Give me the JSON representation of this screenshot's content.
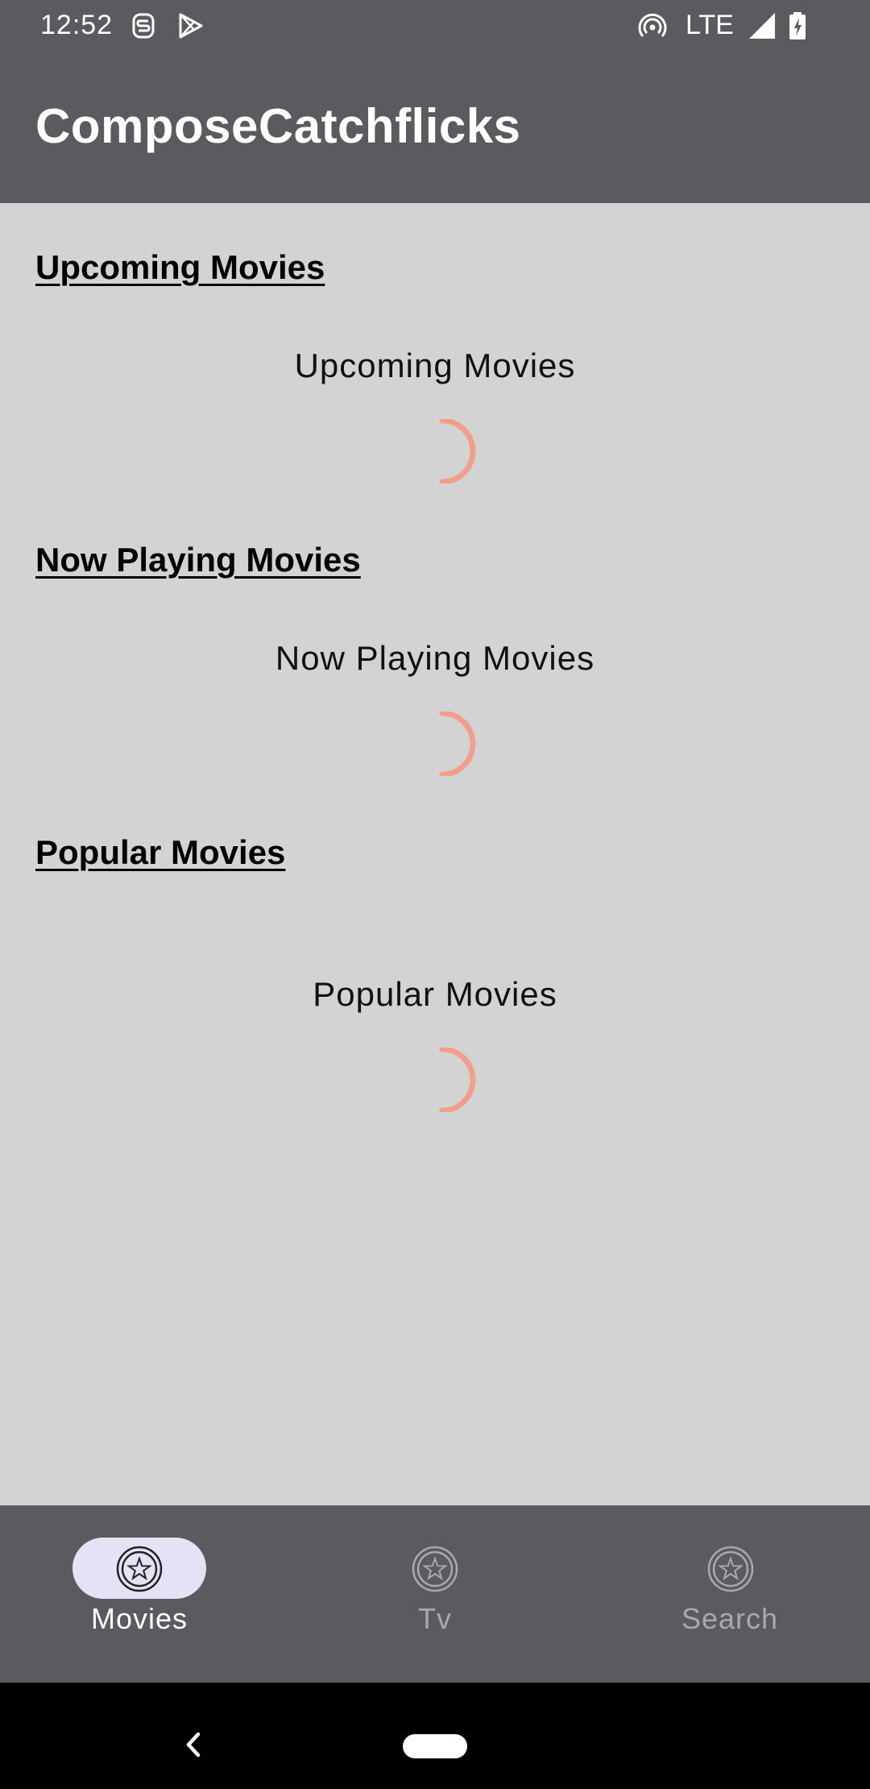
{
  "status_bar": {
    "time": "12:52",
    "network": "LTE",
    "icons": [
      "s-notification-icon",
      "play-store-icon",
      "hotspot-icon",
      "signal-icon",
      "battery-charging-icon"
    ]
  },
  "app_bar": {
    "title": "ComposeCatchflicks"
  },
  "sections": [
    {
      "heading": "Upcoming Movies",
      "placeholder": "Upcoming Movies"
    },
    {
      "heading": "Now Playing Movies",
      "placeholder": "Now Playing Movies"
    },
    {
      "heading": "Popular Movies",
      "placeholder": "Popular Movies"
    }
  ],
  "bottom_nav": {
    "items": [
      {
        "label": "Movies",
        "icon": "star-circle-icon",
        "selected": true
      },
      {
        "label": "Tv",
        "icon": "star-circle-icon",
        "selected": false
      },
      {
        "label": "Search",
        "icon": "star-circle-icon",
        "selected": false
      }
    ]
  },
  "colors": {
    "bar_background": "#5a5b5e",
    "content_background": "#d3d3d3",
    "spinner": "#f0a08a",
    "selected_pill": "#e3e3f5"
  }
}
